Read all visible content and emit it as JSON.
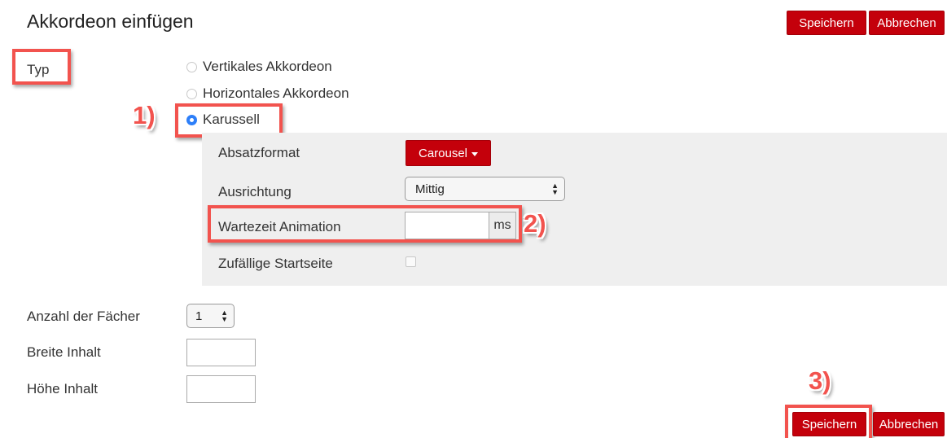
{
  "dialog": {
    "title": "Akkordeon einfügen"
  },
  "top_buttons": {
    "save": "Speichern",
    "cancel": "Abbrechen"
  },
  "bottom_buttons": {
    "save": "Speichern",
    "cancel": "Abbrechen"
  },
  "type": {
    "label": "Typ",
    "options": [
      "Vertikales Akkordeon",
      "Horizontales Akkordeon",
      "Karussell"
    ],
    "selected": "Karussell"
  },
  "carousel": {
    "paragraph_format": {
      "label": "Absatzformat",
      "value": "Carousel"
    },
    "alignment": {
      "label": "Ausrichtung",
      "value": "Mittig"
    },
    "animation_delay": {
      "label": "Wartezeit Animation",
      "value": "",
      "unit": "ms"
    },
    "random_start": {
      "label": "Zufällige Startseite",
      "checked": false
    }
  },
  "panes": {
    "label": "Anzahl der Fächer",
    "value": "1"
  },
  "content_width": {
    "label": "Breite Inhalt",
    "value": ""
  },
  "content_height": {
    "label": "Höhe Inhalt",
    "value": ""
  },
  "annotations": {
    "step1": "1)",
    "step2": "2)",
    "step3": "3)"
  },
  "colors": {
    "primary_button": "#c4000b",
    "highlight": "#f2534e",
    "radio_checked": "#2d7ff9",
    "panel": "#efefef"
  }
}
